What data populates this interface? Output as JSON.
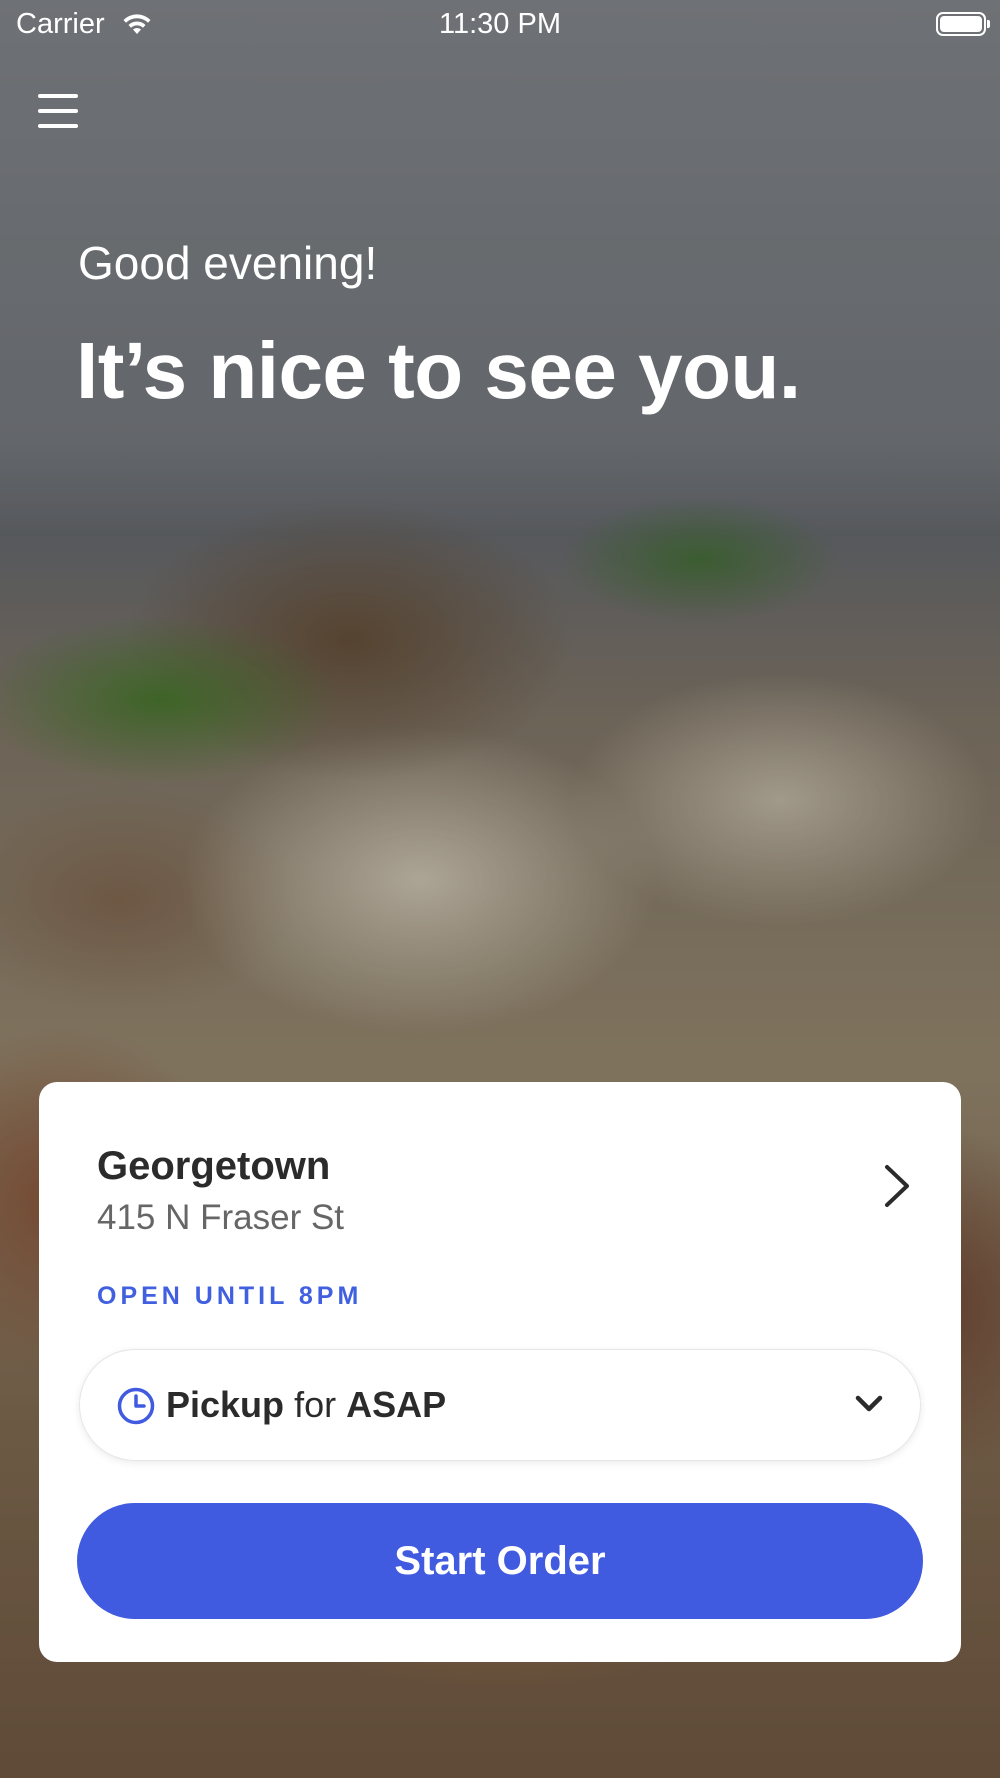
{
  "status_bar": {
    "carrier": "Carrier",
    "time": "11:30 PM"
  },
  "hero": {
    "greeting": "Good evening!",
    "headline": "It’s nice to see you."
  },
  "location": {
    "name": "Georgetown",
    "address": "415 N Fraser St",
    "hours": "OPEN UNTIL 8PM"
  },
  "order_mode": {
    "mode": "Pickup",
    "connector": "for",
    "time": "ASAP"
  },
  "actions": {
    "start_order": "Start Order"
  },
  "colors": {
    "accent": "#405ae0",
    "hours_text": "#4060e0"
  },
  "icons": {
    "menu": "hamburger-menu-icon",
    "wifi": "wifi-icon",
    "battery": "battery-icon",
    "location_arrow": "chevron-right-icon",
    "clock": "clock-icon",
    "dropdown": "chevron-down-icon"
  }
}
